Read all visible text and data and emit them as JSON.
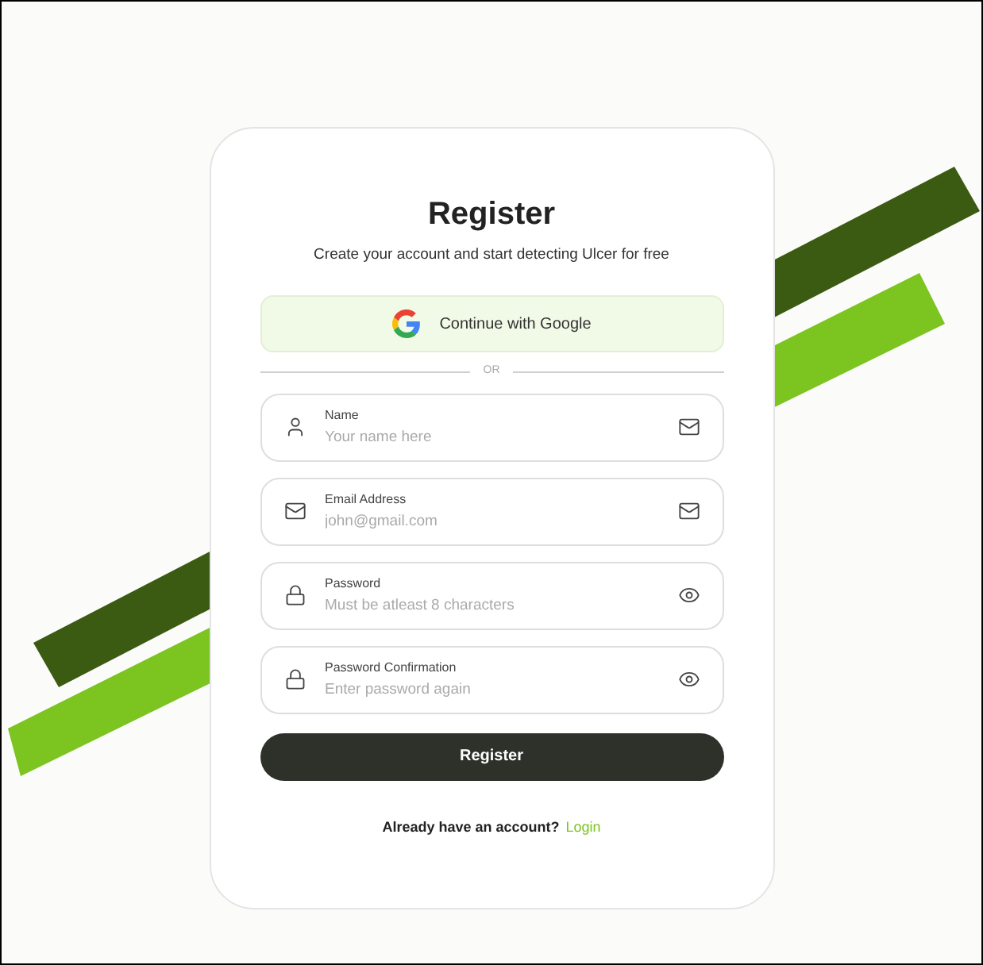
{
  "card": {
    "title": "Register",
    "subtitle": "Create your account and start detecting Ulcer for free"
  },
  "google_button": {
    "label": "Continue with Google"
  },
  "divider": {
    "label": "OR"
  },
  "fields": [
    {
      "kind": "name",
      "label": "Name",
      "placeholder": "Your name here"
    },
    {
      "kind": "email",
      "label": "Email Address",
      "placeholder": "john@gmail.com"
    },
    {
      "kind": "password",
      "label": "Password",
      "placeholder": "Must be atleast 8 characters"
    },
    {
      "kind": "password",
      "label": "Password Confirmation",
      "placeholder": "Enter password again"
    }
  ],
  "submit_button": {
    "label": "Register"
  },
  "footer": {
    "text": "Already have an account?",
    "link": "Login"
  }
}
